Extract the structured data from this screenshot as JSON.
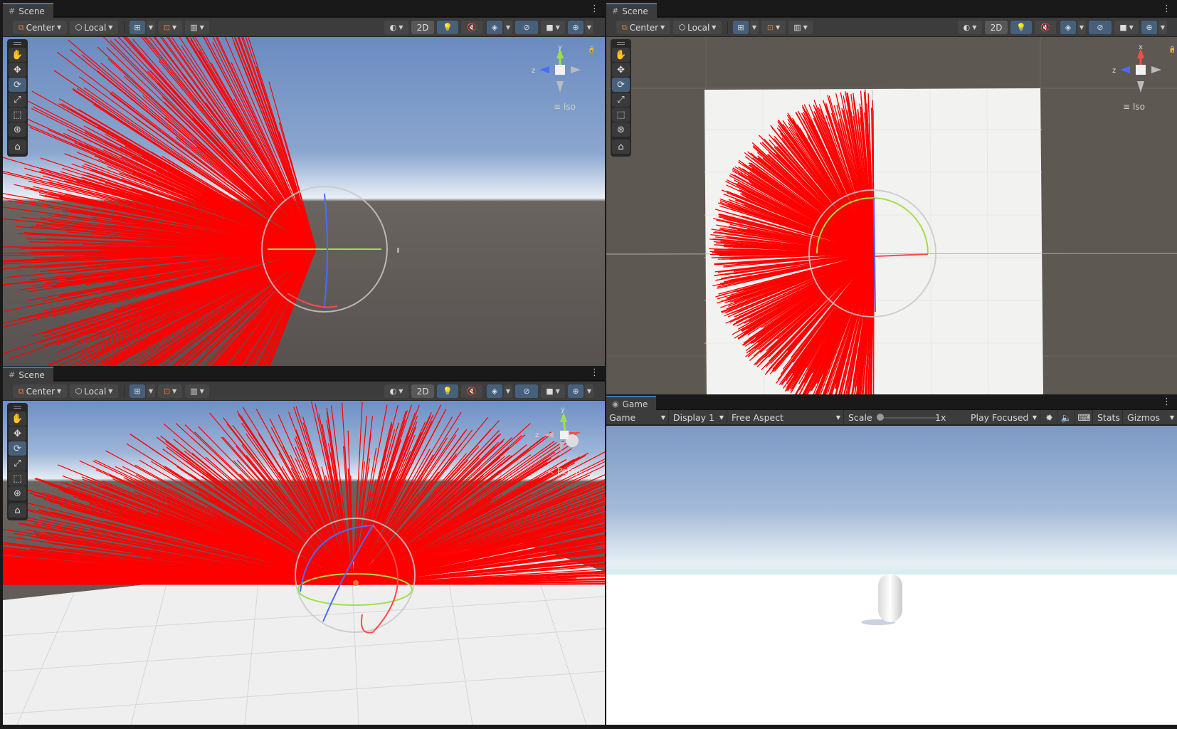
{
  "scene_toolbar": {
    "pivot": "Center",
    "space": "Local",
    "mode_2d": "2D"
  },
  "panels": [
    {
      "tab": "Scene",
      "gizmo_label": "Iso",
      "gizmo_axes": [
        "y",
        "z"
      ]
    },
    {
      "tab": "Scene",
      "gizmo_label": "Iso",
      "gizmo_axes": [
        "x",
        "z"
      ]
    },
    {
      "tab": "Scene",
      "gizmo_label": "Persp",
      "gizmo_axes": [
        "y",
        "z"
      ]
    }
  ],
  "game": {
    "tab": "Game",
    "view_mode": "Game",
    "display": "Display 1",
    "aspect": "Free Aspect",
    "scale_label": "Scale",
    "scale_value": "1x",
    "play_mode": "Play Focused",
    "stats": "Stats",
    "gizmos": "Gizmos"
  },
  "tools": [
    "hand-tool",
    "move-tool",
    "rotate-tool",
    "scale-tool",
    "rect-tool",
    "transform-tool",
    "custom-tool"
  ],
  "colors": {
    "accent": "#3a79bb",
    "selected": "#46607c",
    "rays": "#ff0000",
    "sky": "#7d9ac4",
    "ground": "#5b5652",
    "toolbar": "#3c3c3c"
  }
}
